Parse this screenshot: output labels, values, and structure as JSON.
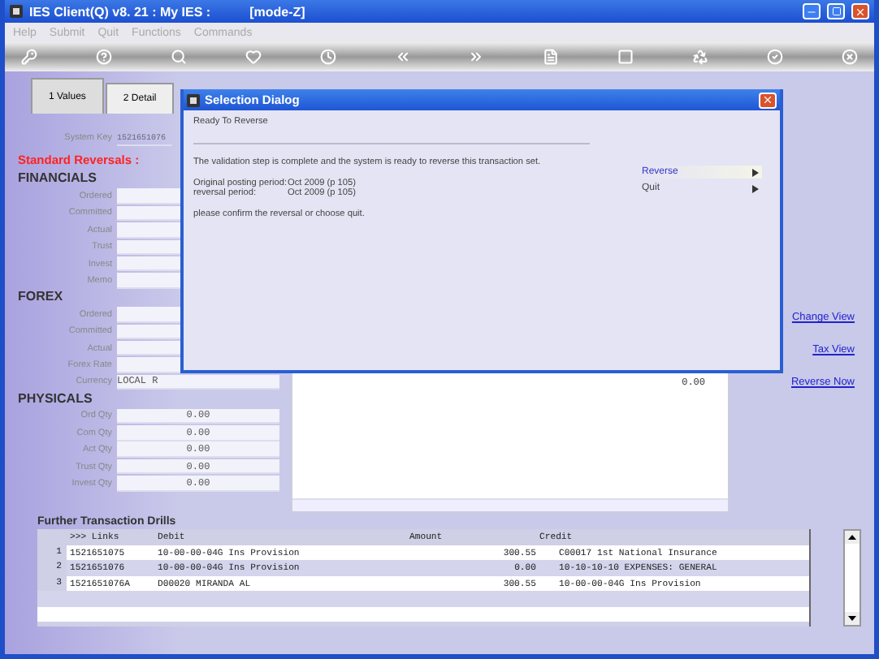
{
  "window": {
    "title": "IES Client(Q) v8. 21 : My IES :",
    "mode": "[mode-Z]"
  },
  "menu": [
    "Help",
    "Submit",
    "Quit",
    "Functions",
    "Commands"
  ],
  "tabs": [
    {
      "label": "1 Values",
      "selected": true
    },
    {
      "label": "2 Detail",
      "selected": false
    }
  ],
  "system_key": {
    "label": "System Key",
    "value": "1521651076"
  },
  "section_title": "Standard Reversals :",
  "groups": [
    {
      "title": "FINANCIALS",
      "fields": [
        {
          "label": "Ordered"
        },
        {
          "label": "Committed"
        },
        {
          "label": "Actual"
        },
        {
          "label": "Trust"
        },
        {
          "label": "Invest"
        },
        {
          "label": "Memo"
        }
      ]
    },
    {
      "title": "FOREX",
      "fields": [
        {
          "label": "Ordered"
        },
        {
          "label": "Committed"
        },
        {
          "label": "Actual"
        },
        {
          "label": "Forex Rate"
        },
        {
          "label": "Currency",
          "value": "LOCAL R"
        }
      ]
    },
    {
      "title": "PHYSICALS",
      "fields": [
        {
          "label": "Ord Qty",
          "value": "0.00"
        },
        {
          "label": "Com Qty",
          "value": "0.00"
        },
        {
          "label": "Act Qty",
          "value": "0.00"
        },
        {
          "label": "Trust Qty",
          "value": "0.00"
        },
        {
          "label": "Invest Qty",
          "value": "0.00"
        }
      ]
    }
  ],
  "detail_amount": "0.00",
  "links": [
    "Change View",
    "Tax View",
    "Reverse Now"
  ],
  "drills": {
    "title": "Further Transaction Drills",
    "columns": [
      ">>> Links",
      "Debit",
      "Amount",
      "Credit"
    ],
    "rows": [
      {
        "number": "1",
        "links": "1521651075",
        "debit": "10-00-00-04G Ins Provision",
        "amount": "300.55",
        "credit": "C00017 1st National Insurance"
      },
      {
        "number": "2",
        "links": "1521651076",
        "debit": "10-00-00-04G Ins Provision",
        "amount": "0.00",
        "credit": "10-10-10-10 EXPENSES: GENERAL"
      },
      {
        "number": "3",
        "links": "1521651076A",
        "debit": "D00020 MIRANDA AL",
        "amount": "300.55",
        "credit": "10-00-00-04G Ins Provision"
      }
    ]
  },
  "dialog": {
    "title": "Selection Dialog",
    "heading": "Ready To Reverse",
    "message": "The validation step is complete and the system is ready to reverse this transaction set.",
    "periods": [
      {
        "label": "Original posting period:",
        "value": "Oct 2009 (p 105)"
      },
      {
        "label": "reversal period:",
        "value": "Oct 2009 (p 105)"
      }
    ],
    "prompt": "please confirm the reversal or choose quit.",
    "options": [
      {
        "label": "Reverse",
        "selected": true
      },
      {
        "label": "Quit",
        "selected": false
      }
    ]
  }
}
